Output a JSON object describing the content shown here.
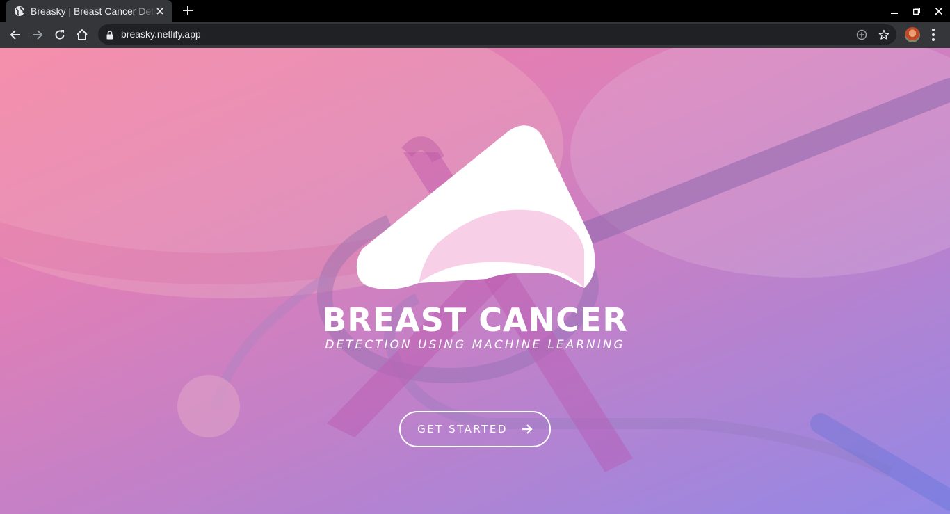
{
  "browser": {
    "tab": {
      "title": "Breasky | Breast Cancer Detection"
    },
    "url": "breasky.netlify.app"
  },
  "hero": {
    "title": "BREAST CANCER",
    "subtitle": "DETECTION USING MACHINE LEARNING",
    "cta_label": "GET STARTED"
  },
  "icons": {
    "favicon": "globe-icon",
    "cta_arrow": "arrow-right-icon"
  },
  "colors": {
    "gradient_start": "#f07aa0",
    "gradient_end": "#9d86e0",
    "chrome": "#35363a",
    "omnibox": "#202124",
    "text": "#ffffff"
  }
}
